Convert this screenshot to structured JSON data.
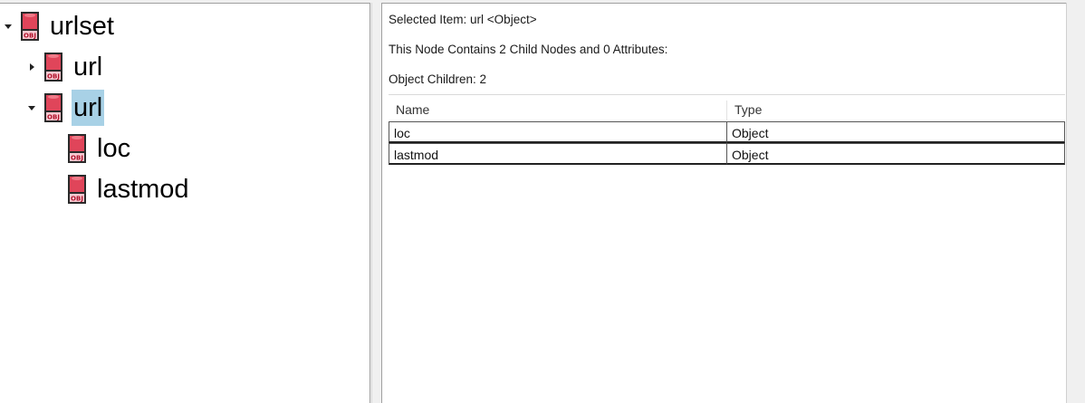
{
  "tree": {
    "nodes": [
      {
        "label": "urlset",
        "expander": "expanded",
        "icon": "obj-icon",
        "selected": false
      },
      {
        "label": "url",
        "expander": "collapsed",
        "icon": "obj-icon",
        "selected": false
      },
      {
        "label": "url",
        "expander": "expanded",
        "icon": "obj-icon",
        "selected": true
      },
      {
        "label": "loc",
        "expander": "none",
        "icon": "obj-icon",
        "selected": false
      },
      {
        "label": "lastmod",
        "expander": "none",
        "icon": "obj-icon",
        "selected": false
      }
    ],
    "icon_text": "OBJ"
  },
  "details": {
    "selected_item": "Selected Item: url <Object>",
    "summary": "This Node Contains 2 Child Nodes and 0 Attributes:",
    "children_count": "Object Children: 2"
  },
  "grid": {
    "columns": [
      "Name",
      "Type"
    ],
    "rows": [
      [
        "loc",
        "Object"
      ],
      [
        "lastmod",
        "Object"
      ]
    ]
  },
  "colors": {
    "selection": "#a8d1e6",
    "icon_red": "#e0455a"
  }
}
